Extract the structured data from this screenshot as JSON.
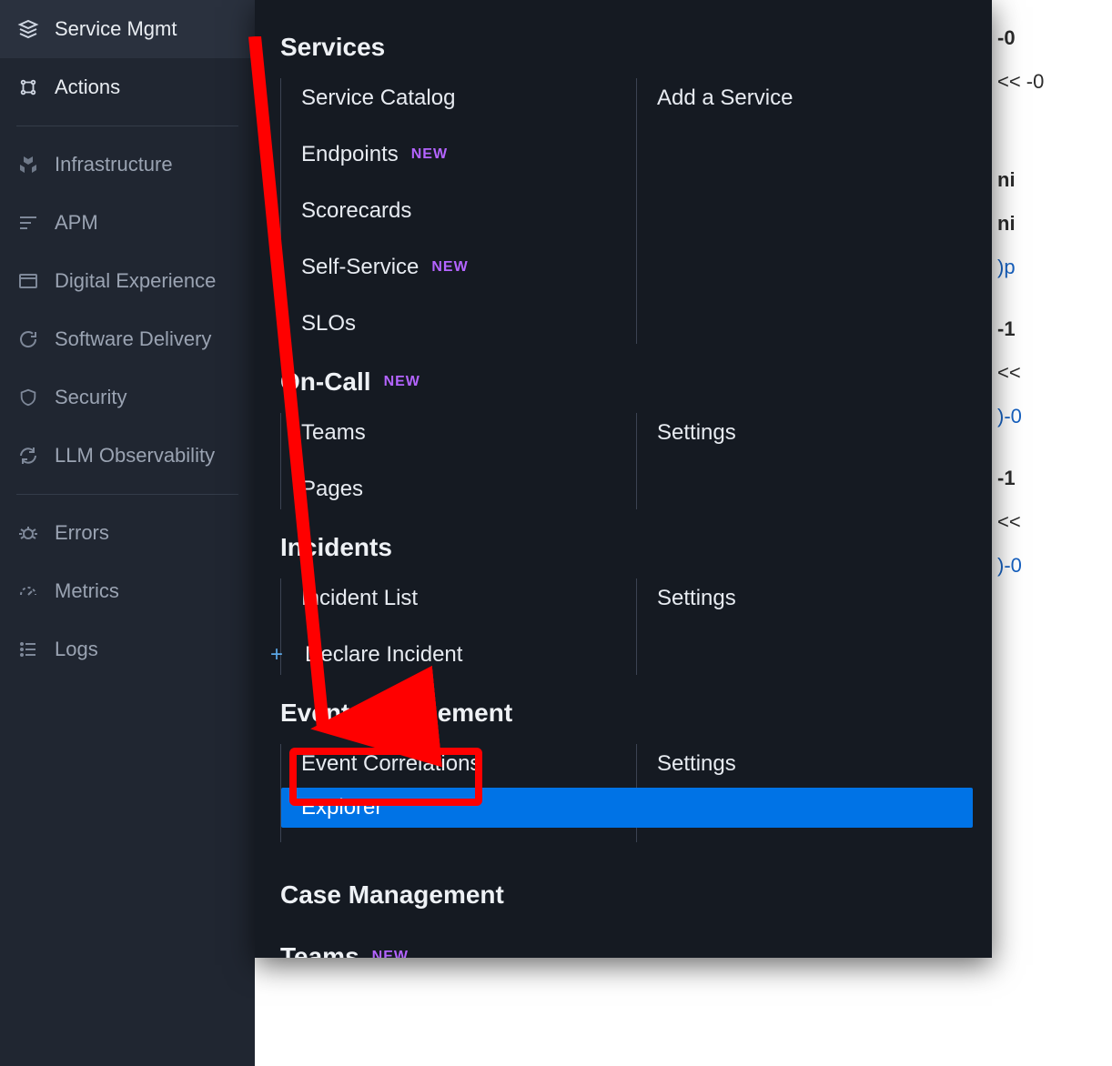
{
  "sidebar": {
    "items": [
      {
        "label": "Service Mgmt",
        "icon": "layers"
      },
      {
        "label": "Actions",
        "icon": "bolt"
      },
      {
        "label": "Infrastructure",
        "icon": "hex"
      },
      {
        "label": "APM",
        "icon": "lines"
      },
      {
        "label": "Digital Experience",
        "icon": "browser"
      },
      {
        "label": "Software Delivery",
        "icon": "cycle"
      },
      {
        "label": "Security",
        "icon": "shield"
      },
      {
        "label": "LLM Observability",
        "icon": "refresh"
      },
      {
        "label": "Errors",
        "icon": "bug"
      },
      {
        "label": "Metrics",
        "icon": "gauge"
      },
      {
        "label": "Logs",
        "icon": "list"
      }
    ]
  },
  "flyout": {
    "badge_new": "NEW",
    "sections": [
      {
        "heading": "Services",
        "col1": [
          "Service Catalog",
          "Endpoints",
          "Scorecards",
          "Self-Service",
          "SLOs"
        ],
        "col1_badges": {
          "Endpoints": true,
          "Self-Service": true
        },
        "col2": [
          "Add a Service"
        ]
      },
      {
        "heading": "On-Call",
        "heading_badge": true,
        "col1": [
          "Teams",
          "Pages"
        ],
        "col2": [
          "Settings"
        ]
      },
      {
        "heading": "Incidents",
        "col1": [
          "Incident List",
          "Declare Incident"
        ],
        "col1_plus": {
          "Declare Incident": true
        },
        "col2": [
          "Settings"
        ]
      },
      {
        "heading": "Event Management",
        "col1": [
          "Event Correlations",
          "Explorer"
        ],
        "col1_selected": {
          "Explorer": true
        },
        "col2": [
          "Settings"
        ]
      },
      {
        "heading": "Case Management",
        "col1": [],
        "col2": []
      },
      {
        "heading": "Teams",
        "heading_badge": true,
        "col1": [],
        "col2": []
      }
    ]
  },
  "bg_sliver": {
    "rows": [
      {
        "text": "-0",
        "style": "bold"
      },
      {
        "text": "<< -0",
        "style": "lt"
      },
      {
        "text": "",
        "style": ""
      },
      {
        "text": "ni",
        "style": "bold"
      },
      {
        "text": "ni",
        "style": "bold"
      },
      {
        "text": ")p",
        "style": "code"
      },
      {
        "text": "-1",
        "style": "bold"
      },
      {
        "text": "<<",
        "style": "lt"
      },
      {
        "text": ")-0",
        "style": "code"
      },
      {
        "text": "-1",
        "style": "bold"
      },
      {
        "text": "<<",
        "style": "lt"
      },
      {
        "text": ")-0",
        "style": "code"
      }
    ]
  }
}
